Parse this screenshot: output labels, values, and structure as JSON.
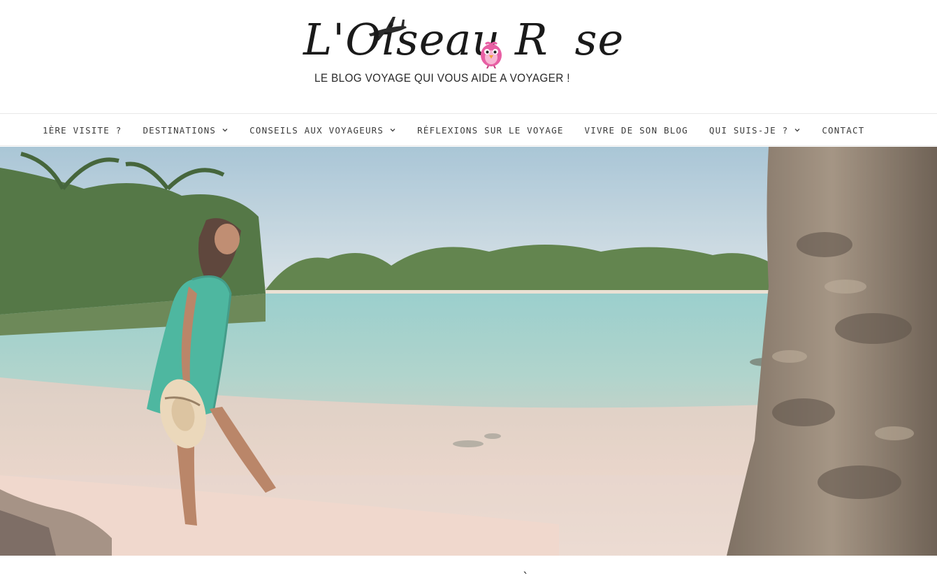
{
  "site": {
    "logo_text_1": "L'Oiseau R",
    "logo_text_2": "se",
    "tagline": "LE BLOG VOYAGE QUI VOUS AIDE A VOYAGER !"
  },
  "nav": {
    "items": [
      {
        "label": "1ère visite ?",
        "has_dropdown": false
      },
      {
        "label": "Destinations",
        "has_dropdown": true
      },
      {
        "label": "Conseils aux voyageurs",
        "has_dropdown": true
      },
      {
        "label": "Réflexions sur le voyage",
        "has_dropdown": false
      },
      {
        "label": "Vivre de son blog",
        "has_dropdown": false
      },
      {
        "label": "Qui suis-je ?",
        "has_dropdown": true
      },
      {
        "label": "Contact",
        "has_dropdown": false
      }
    ]
  },
  "icons": {
    "plane": "plane-icon",
    "bird": "pink-bird-icon",
    "dropdown": "chevron-down-icon"
  },
  "colors": {
    "text": "#3b3b3b",
    "brand_pink": "#e85fa4",
    "lagoon": "#7fc7c4",
    "sand": "#e9d3c7"
  },
  "below_fold": {
    "peek_char": "`"
  }
}
